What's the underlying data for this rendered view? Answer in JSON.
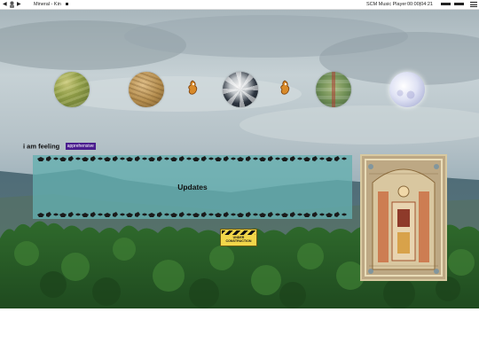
{
  "player": {
    "prev_label": "◀",
    "next_label": "▶",
    "track": "Mineral - Kin",
    "brand": "SCM Music Player",
    "time": "00:00|04:21"
  },
  "orbs": [
    "field-orb",
    "grain-orb",
    "earth-orb",
    "farm-orb",
    "moon-orb"
  ],
  "mood": {
    "label": "i am feeling",
    "value": "apprehensive"
  },
  "updates": {
    "title": "Updates"
  },
  "construction_sign": {
    "line1": "UNDER",
    "line2": "CONSTRUCTION"
  },
  "colors": {
    "panel": "#64afaf",
    "mood_badge": "#4a1d8e",
    "sign": "#f2d64a"
  }
}
